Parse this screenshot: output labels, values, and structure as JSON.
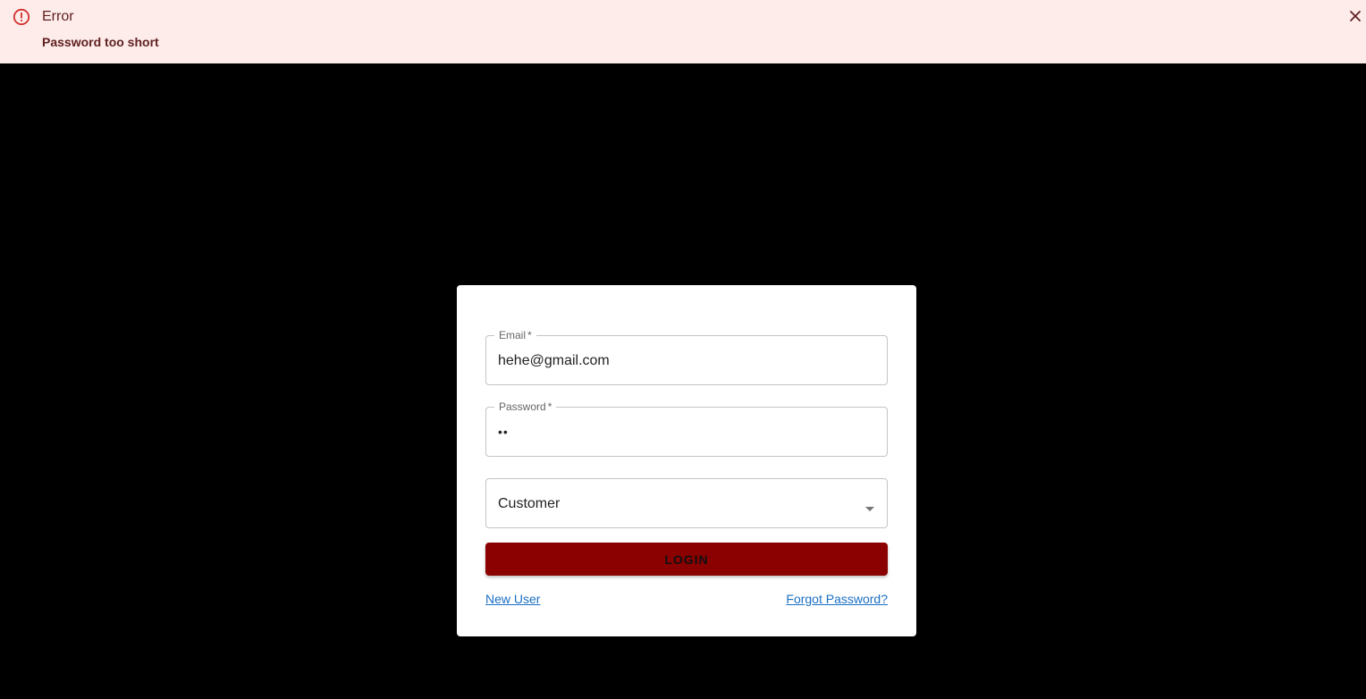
{
  "alert": {
    "icon": "error-outline-icon",
    "title": "Error",
    "message": "Password too short",
    "close_icon": "close-icon",
    "background": "#fdecea",
    "text_color": "#5f2120",
    "icon_color": "#d32f2f"
  },
  "form": {
    "email": {
      "label": "Email",
      "required_mark": "*",
      "value": "hehe@gmail.com"
    },
    "password": {
      "label": "Password",
      "required_mark": "*",
      "value": "••"
    },
    "role": {
      "selected": "Customer",
      "icon": "dropdown-arrow-icon"
    },
    "login_button": {
      "label": "LOGIN",
      "color": "#8b0000"
    },
    "links": {
      "new_user": "New User",
      "forgot_password": "Forgot Password?"
    }
  }
}
